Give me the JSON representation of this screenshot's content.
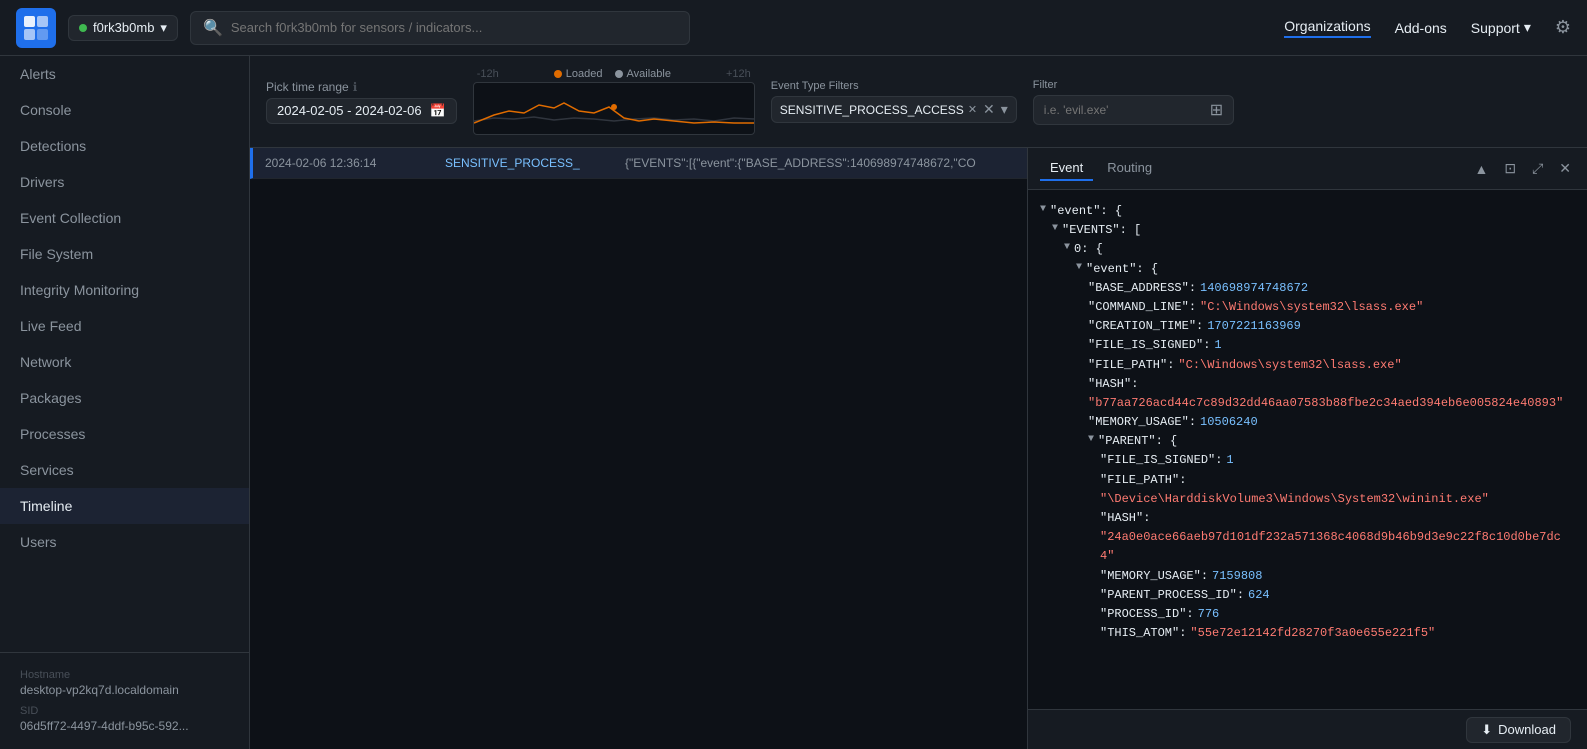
{
  "nav": {
    "org_name": "f0rk3b0mb",
    "search_placeholder": "Search f0rk3b0mb for sensors / indicators...",
    "links": [
      "Organizations",
      "Add-ons",
      "Support"
    ],
    "support_label": "Support"
  },
  "sidebar": {
    "items": [
      {
        "label": "Alerts",
        "active": false
      },
      {
        "label": "Console",
        "active": false
      },
      {
        "label": "Detections",
        "active": false
      },
      {
        "label": "Drivers",
        "active": false
      },
      {
        "label": "Event Collection",
        "active": false
      },
      {
        "label": "File System",
        "active": false
      },
      {
        "label": "Integrity Monitoring",
        "active": false
      },
      {
        "label": "Live Feed",
        "active": false
      },
      {
        "label": "Network",
        "active": false
      },
      {
        "label": "Packages",
        "active": false
      },
      {
        "label": "Processes",
        "active": false
      },
      {
        "label": "Services",
        "active": false
      },
      {
        "label": "Timeline",
        "active": true
      },
      {
        "label": "Users",
        "active": false
      }
    ],
    "hostname_label": "Hostname",
    "hostname_value": "desktop-vp2kq7d.localdomain",
    "sid_label": "SID",
    "sid_value": "06d5ff72-4497-4ddf-b95c-592..."
  },
  "filter_bar": {
    "time_range_label": "Pick time range",
    "time_range_value": "2024-02-05 - 2024-02-06",
    "chart_label_left": "-12h",
    "chart_label_right": "+12h",
    "legend_loaded": "Loaded",
    "legend_available": "Available",
    "event_filter_label": "Event Type Filters",
    "event_tag": "SENSITIVE_PROCESS_ACCESS",
    "filter_label": "Filter",
    "filter_placeholder": "i.e. 'evil.exe'"
  },
  "table": {
    "rows": [
      {
        "time": "2024-02-06 12:36:14",
        "type": "SENSITIVE_PROCESS_",
        "data": "{\"EVENTS\":[{\"event\":{\"BASE_ADDRESS\":140698974748672,\"CO"
      }
    ]
  },
  "detail": {
    "tabs": [
      "Event",
      "Routing"
    ],
    "active_tab": "Event",
    "json": {
      "event_key": "\"event\": {",
      "events_key": "\"EVENTS\": [",
      "base_address_key": "\"BASE_ADDRESS\":",
      "base_address_val": "140698974748672",
      "command_line_key": "\"COMMAND_LINE\":",
      "command_line_val": "\"C:\\Windows\\system32\\lsass.exe\"",
      "creation_time_key": "\"CREATION_TIME\":",
      "creation_time_val": "1707221163969",
      "file_is_signed_key": "\"FILE_IS_SIGNED\":",
      "file_is_signed_val": "1",
      "file_path_key": "\"FILE_PATH\":",
      "file_path_val": "\"C:\\Windows\\system32\\lsass.exe\"",
      "hash_key": "\"HASH\":",
      "hash_val": "\"b77aa726acd44c7c89d32dd46aa07583b88fbe2c34aed394eb6e005824e40893\"",
      "memory_usage_key": "\"MEMORY_USAGE\":",
      "memory_usage_val": "10506240",
      "parent_key": "\"PARENT\": {",
      "parent_file_is_signed_key": "\"FILE_IS_SIGNED\":",
      "parent_file_is_signed_val": "1",
      "parent_file_path_key": "\"FILE_PATH\":",
      "parent_file_path_val": "\"\\Device\\HarddiskVolume3\\Windows\\System32\\wininit.exe\"",
      "parent_hash_key": "\"HASH\":",
      "parent_hash_val": "\"24a0e0ace66aeb97d101df232a571368c4068d9b46b9d3e9c22f8c10d0be7dc4\"",
      "parent_memory_usage_key": "\"MEMORY_USAGE\":",
      "parent_memory_usage_val": "7159808",
      "parent_process_id_key": "\"PARENT_PROCESS_ID\":",
      "parent_process_id_val": "624",
      "process_id_key": "\"PROCESS_ID\":",
      "process_id_val": "776",
      "this_atom_key": "\"THIS_ATOM\":",
      "this_atom_val": "\"55e72e12142fd28270f3a0e655e221f5\""
    }
  },
  "bottom_bar": {
    "download_label": "Download"
  }
}
